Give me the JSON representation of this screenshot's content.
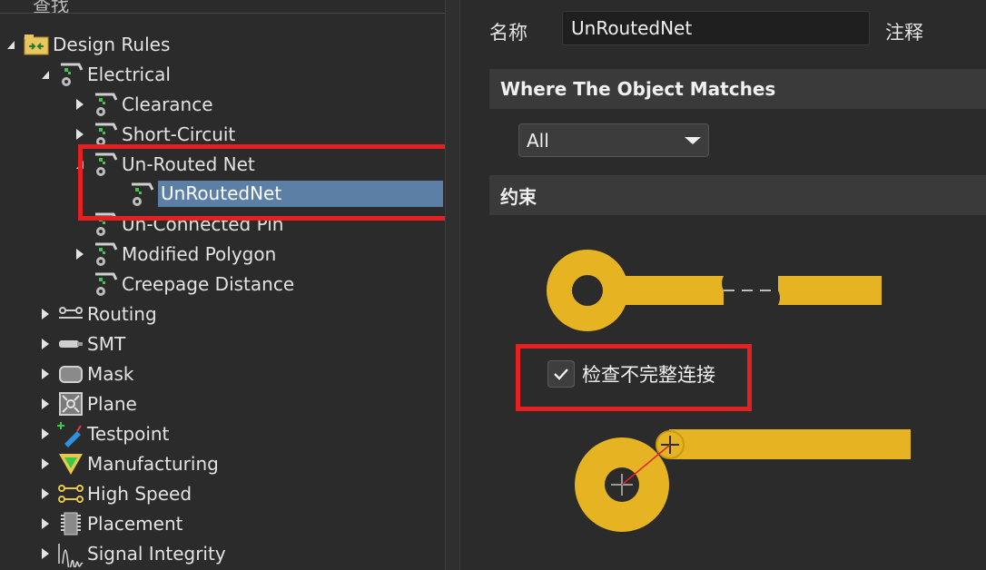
{
  "search": {
    "label": "查找"
  },
  "tree": {
    "root": "Design Rules",
    "electrical": "Electrical",
    "clearance": "Clearance",
    "short_circuit": "Short-Circuit",
    "un_routed_net": "Un-Routed Net",
    "unroutednet_rule": "UnRoutedNet",
    "un_connected_pin": "Un-Connected Pin",
    "modified_polygon": "Modified Polygon",
    "creepage_distance": "Creepage Distance",
    "routing": "Routing",
    "smt": "SMT",
    "mask": "Mask",
    "plane": "Plane",
    "testpoint": "Testpoint",
    "manufacturing": "Manufacturing",
    "high_speed": "High Speed",
    "placement": "Placement",
    "signal_integrity": "Signal Integrity"
  },
  "rule": {
    "name_label": "名称",
    "name_value": "UnRoutedNet",
    "comment_label": "注释",
    "where_header": "Where The Object Matches",
    "scope_value": "All",
    "constraints_header": "约束",
    "check_incomplete_label": "检查不完整连接",
    "check_incomplete_checked": true
  },
  "colors": {
    "pad": "#e6b422",
    "selection": "#5b7fa5",
    "highlight_box": "#e62020",
    "background": "#2b2b2b"
  }
}
